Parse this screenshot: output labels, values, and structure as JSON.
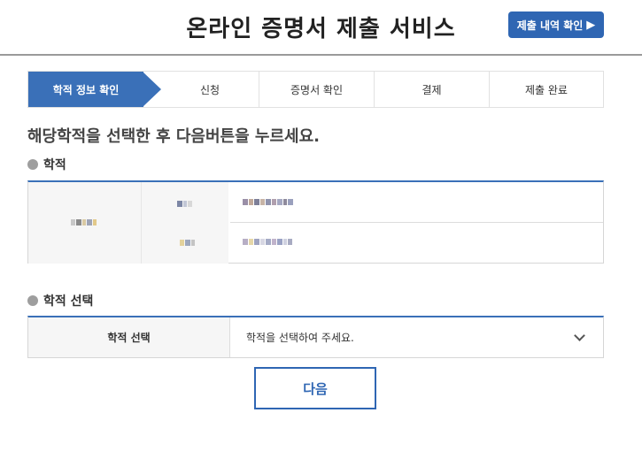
{
  "header": {
    "title": "온라인 증명서 제출 서비스",
    "history_button": "제출 내역 확인",
    "history_icon": "triangle-right-icon"
  },
  "steps": [
    {
      "label": "학적 정보 확인",
      "active": true
    },
    {
      "label": "신청",
      "active": false
    },
    {
      "label": "증명서 확인",
      "active": false
    },
    {
      "label": "결제",
      "active": false
    },
    {
      "label": "제출 완료",
      "active": false
    }
  ],
  "instruction": "해당학적을 선택한 후 다음버튼을 누르세요.",
  "academic_section": {
    "label": "학적"
  },
  "select_section": {
    "label": "학적 선택",
    "field_label": "학적 선택",
    "selected_value": "학적을 선택하여 주세요."
  },
  "next_button": "다음",
  "colors": {
    "accent": "#3a70b8",
    "button_blue": "#2f66b3",
    "section_dot": "#9e9e9e"
  }
}
